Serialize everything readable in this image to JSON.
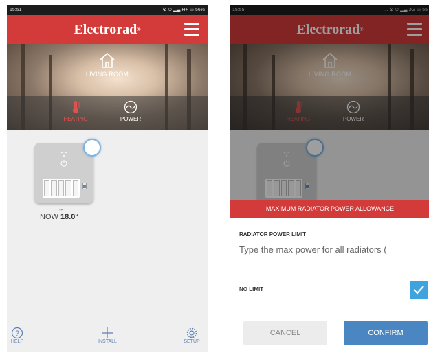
{
  "screens": [
    {
      "status": {
        "time": "15:51",
        "right": "⚙ ⏱ ▂▄ H+ ▭ 56%"
      },
      "brand": "Electrorad",
      "room": {
        "label": "LIVING ROOM",
        "icon": "home-icon"
      },
      "modes": [
        {
          "label": "HEATING",
          "icon": "thermometer-icon",
          "color": "#e05252"
        },
        {
          "label": "POWER",
          "icon": "power-wave-icon",
          "color": "#ffffff"
        }
      ],
      "device": {
        "dash": "--",
        "now_label": "NOW",
        "now_value": "18.0°"
      },
      "nav": [
        {
          "label": "HELP",
          "icon": "help-icon"
        },
        {
          "label": "INSTALL",
          "icon": "plus-icon"
        },
        {
          "label": "SETUP",
          "icon": "gear-icon"
        }
      ]
    },
    {
      "status": {
        "time": "15:55",
        "right": "… ⚙ ⏱ ▂▄ 3G ▭ 55"
      },
      "brand": "Electrorad",
      "room": {
        "label": "LIVING ROOM"
      },
      "modes": [
        {
          "label": "HEATING"
        },
        {
          "label": "POWER"
        }
      ],
      "dialog": {
        "title": "MAXIMUM RADIATOR POWER ALLOWANCE",
        "field_label": "RADIATOR POWER LIMIT",
        "placeholder": "Type the max power for all radiators (",
        "no_limit_label": "NO LIMIT",
        "no_limit_checked": true,
        "cancel_label": "CANCEL",
        "confirm_label": "CONFIRM"
      }
    }
  ],
  "colors": {
    "brand_red": "#d33a3a",
    "accent_blue": "#4a87c2",
    "check_blue": "#3fa3dd"
  }
}
